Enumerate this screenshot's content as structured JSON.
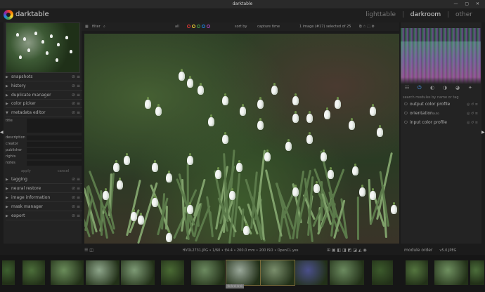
{
  "titlebar": {
    "title": "darktable",
    "controls": "— ▢ ✕"
  },
  "app": {
    "name": "darktable"
  },
  "views": {
    "lighttable": "lighttable",
    "sep": "|",
    "darkroom": "darkroom",
    "other": "other"
  },
  "toolbar": {
    "filter_label": "filter",
    "all_label": "all",
    "sort_label": "sort by",
    "sort_value": "capture time",
    "count": "1 image (#17) selected of 25"
  },
  "left_modules": [
    "snapshots",
    "history",
    "duplicate manager",
    "color picker",
    "metadata editor",
    "tagging",
    "neural restore",
    "image information",
    "mask manager",
    "export"
  ],
  "metadata": {
    "fields": [
      "title",
      "description",
      "creator",
      "publisher",
      "rights",
      "notes"
    ],
    "apply": "apply",
    "cancel": "cancel"
  },
  "right": {
    "search_placeholder": "search modules by name or tag",
    "modules": [
      {
        "name": "output color profile",
        "sub": ""
      },
      {
        "name": "orientation",
        "sub": "auto"
      },
      {
        "name": "input color profile",
        "sub": ""
      }
    ]
  },
  "bottom": {
    "info": "HVOL2731.JPG • 1/60 • f/4.4 • 200.0 mm • 200 ISO • OpenCL yes",
    "module_order": "module order",
    "version": "v5.0.JPEG"
  },
  "filmstrip": {
    "stars": "☆☆☆☆☆"
  },
  "colors": {
    "accent": "#4da3ff"
  }
}
